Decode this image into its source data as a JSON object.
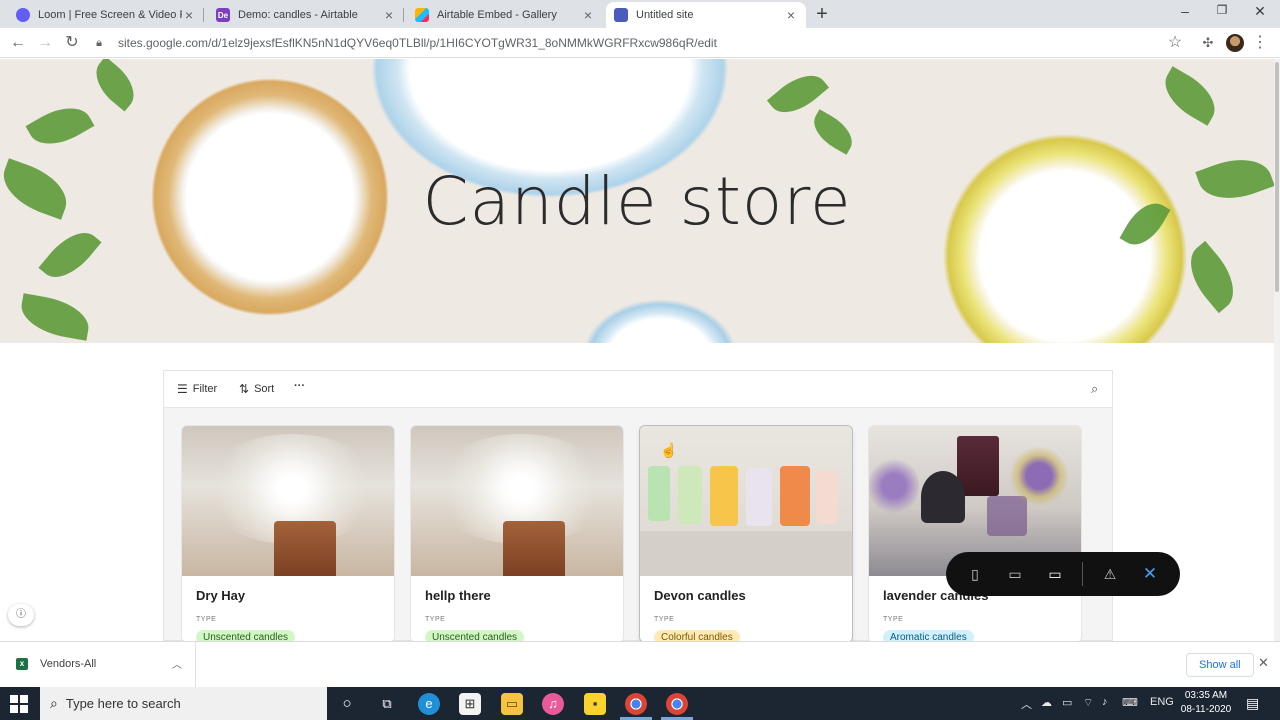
{
  "browser": {
    "tabs": [
      {
        "title": "Loom | Free Screen & Video Rec",
        "favicon_color": "#625df5",
        "active": false
      },
      {
        "title": "Demo: candles - Airtable",
        "favicon_color": "#7b3fbf",
        "favicon_text": "De",
        "active": false
      },
      {
        "title": "Airtable Embed - Gallery",
        "favicon_color": "#fcb400",
        "active": false
      },
      {
        "title": "Untitled site",
        "favicon_color": "#4a5dbd",
        "active": true
      }
    ],
    "url": "sites.google.com/d/1elz9jexsfEsflKN5nN1dQYV6eq0TLBll/p/1HI6CYOTgWR31_8oNMMkWGRFRxcw986qR/edit"
  },
  "hero": {
    "title": "Candle store"
  },
  "gallery": {
    "toolbar": {
      "filter_label": "Filter",
      "sort_label": "Sort",
      "more_label": "···"
    },
    "field_label": "TYPE",
    "cards": [
      {
        "title": "Dry Hay",
        "type": "Unscented candles",
        "badge_color": "#d1f7c4"
      },
      {
        "title": "hellp there",
        "type": "Unscented candles",
        "badge_color": "#d1f7c4"
      },
      {
        "title": "Devon candles",
        "type": "Colorful candles",
        "badge_color": "#ffeab6"
      },
      {
        "title": "lavender candles",
        "type": "Aromatic candles",
        "badge_color": "#d0f0fd"
      }
    ]
  },
  "download_bar": {
    "file_name": "Vendors-All",
    "show_all_label": "Show all"
  },
  "taskbar": {
    "search_placeholder": "Type here to search",
    "time": "03:35 AM",
    "date": "08-11-2020",
    "language": "ENG"
  }
}
